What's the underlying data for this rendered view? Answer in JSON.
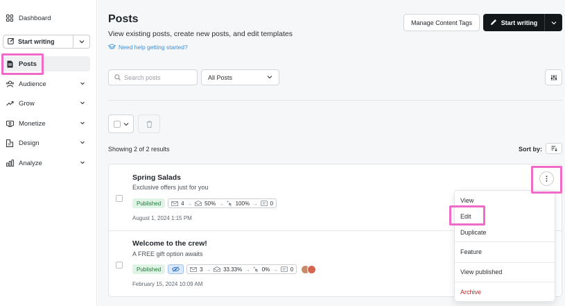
{
  "sidebar": {
    "items": [
      {
        "label": "Dashboard",
        "icon": "grid-icon"
      },
      {
        "label": "Posts",
        "icon": "document-icon"
      },
      {
        "label": "Audience",
        "icon": "audience-icon"
      },
      {
        "label": "Grow",
        "icon": "trend-up-icon"
      },
      {
        "label": "Monetize",
        "icon": "monetize-icon"
      },
      {
        "label": "Design",
        "icon": "design-icon"
      },
      {
        "label": "Analyze",
        "icon": "bar-chart-icon"
      }
    ],
    "start_writing": "Start writing",
    "active_item": "Posts"
  },
  "header": {
    "title": "Posts",
    "subtitle": "View existing posts, create new posts, and edit templates",
    "help_link": "Need help getting started?",
    "manage_tags": "Manage Content Tags",
    "start_writing": "Start writing"
  },
  "filters": {
    "search_placeholder": "Search posts",
    "select_value": "All Posts"
  },
  "list": {
    "results_text": "Showing 2 of 2 results",
    "sort_label": "Sort by:",
    "posts": [
      {
        "title": "Spring Salads",
        "subtitle": "Exclusive offers just for you",
        "status": "Published",
        "recipients": "4",
        "open_rate": "50%",
        "click_rate": "100%",
        "comments": "0",
        "date": "August 1, 2024 1:15 PM"
      },
      {
        "title": "Welcome to the crew!",
        "subtitle": "A FREE gift option awaits",
        "status": "Published",
        "recipients": "3",
        "open_rate": "33.33%",
        "click_rate": "0%",
        "comments": "0",
        "date": "February 15, 2024 10:09 AM"
      }
    ]
  },
  "menu": {
    "items": [
      "View",
      "Edit",
      "Duplicate",
      "Feature",
      "View published",
      "Archive"
    ]
  },
  "colors": {
    "highlight": "#f06bc7",
    "primary_button": "#14171a",
    "published_badge_bg": "#dff4e4",
    "published_badge_text": "#1d7a3a",
    "archive_text": "#c22b2b",
    "link": "#3f8fd9"
  }
}
